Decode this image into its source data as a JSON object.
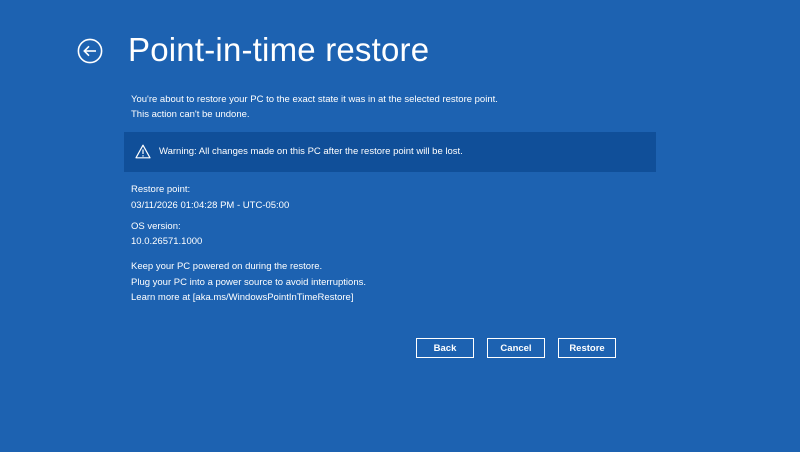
{
  "page": {
    "title": "Point-in-time restore",
    "intro_line1": "You're about to restore your PC to the exact state it was in at the selected restore point.",
    "intro_line2": "This action can't be undone."
  },
  "warning": {
    "text": "Warning: All changes made on this PC after the restore point will be lost.",
    "icon": "warning-triangle-icon"
  },
  "restore_point": {
    "label": "Restore point:",
    "value": "03/11/2026 01:04:28 PM - UTC-05:00"
  },
  "os_version": {
    "label": "OS version:",
    "value": "10.0.26571.1000"
  },
  "notes": {
    "line1": "Keep your PC powered on during the restore.",
    "line2": "Plug your PC into a power source to avoid interruptions.",
    "line3": "Learn more at [aka.ms/WindowsPointInTimeRestore]"
  },
  "buttons": {
    "back": "Back",
    "cancel": "Cancel",
    "restore": "Restore"
  },
  "colors": {
    "background": "#1d62b1",
    "warning_bar": "#104f99",
    "text": "#ffffff"
  },
  "icons": {
    "back": "back-arrow-icon",
    "warning": "warning-triangle-icon"
  }
}
